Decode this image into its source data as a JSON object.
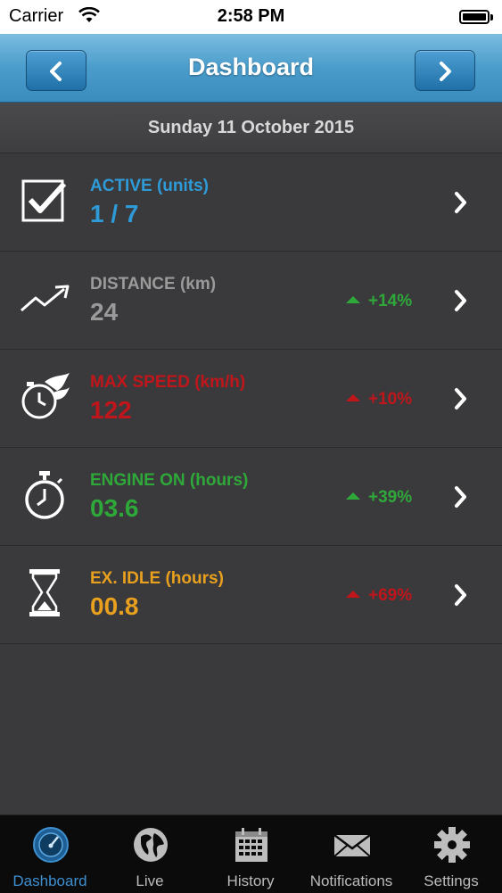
{
  "status_bar": {
    "carrier": "Carrier",
    "time": "2:58 PM"
  },
  "nav": {
    "title": "Dashboard",
    "back_icon": "chevron-left-icon",
    "forward_icon": "chevron-right-icon"
  },
  "date": "Sunday 11 October 2015",
  "rows": [
    {
      "label": "ACTIVE (units)",
      "value": "1 / 7",
      "trend": "",
      "color": "#2e9bd8",
      "trend_color": "",
      "icon": "checkbox-icon"
    },
    {
      "label": "DISTANCE (km)",
      "value": "24",
      "trend": "+14%",
      "color": "#9a9a9a",
      "trend_color": "#2fa83a",
      "icon": "trend-line-icon"
    },
    {
      "label": "MAX SPEED (km/h)",
      "value": "122",
      "trend": "+10%",
      "color": "#c0161b",
      "trend_color": "#c0161b",
      "icon": "speed-clock-icon"
    },
    {
      "label": "ENGINE ON (hours)",
      "value": "03.6",
      "trend": "+39%",
      "color": "#2fa83a",
      "trend_color": "#2fa83a",
      "icon": "stopwatch-icon"
    },
    {
      "label": "EX. IDLE (hours)",
      "value": "00.8",
      "trend": "+69%",
      "color": "#e8a01e",
      "trend_color": "#c0161b",
      "icon": "hourglass-icon"
    }
  ],
  "tabs": [
    {
      "label": "Dashboard",
      "icon": "speedometer-icon",
      "active": true
    },
    {
      "label": "Live",
      "icon": "globe-icon",
      "active": false
    },
    {
      "label": "History",
      "icon": "calendar-icon",
      "active": false
    },
    {
      "label": "Notifications",
      "icon": "envelope-icon",
      "active": false
    },
    {
      "label": "Settings",
      "icon": "gear-icon",
      "active": false
    }
  ],
  "colors": {
    "nav_blue": "#4a9ccb",
    "active_tab": "#3e8fd0",
    "background": "#3a3a3c"
  }
}
